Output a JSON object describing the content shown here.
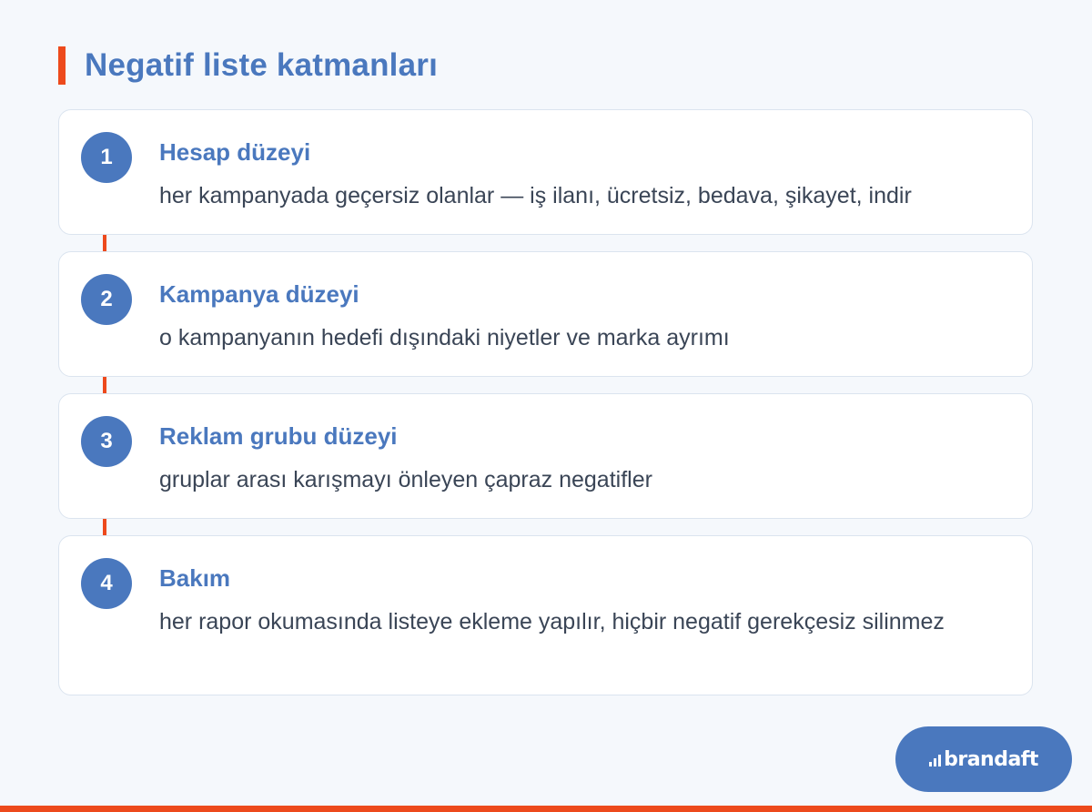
{
  "page": {
    "title": "Negatif liste katmanları"
  },
  "steps": [
    {
      "number": "1",
      "title": "Hesap düzeyi",
      "description": "her kampanyada geçersiz olanlar — iş ilanı, ücretsiz, bedava, şikayet, indir"
    },
    {
      "number": "2",
      "title": "Kampanya düzeyi",
      "description": "o kampanyanın hedefi dışındaki niyetler ve marka ayrımı"
    },
    {
      "number": "3",
      "title": "Reklam grubu düzeyi",
      "description": "gruplar arası karışmayı önleyen çapraz negatifler"
    },
    {
      "number": "4",
      "title": "Bakım",
      "description": "her rapor okumasında listeye ekleme yapılır, hiçbir negatif gerekçesiz silinmez"
    }
  ],
  "brand": {
    "name": "brandaft",
    "icon": "bar-chart-icon"
  },
  "colors": {
    "accent": "#ed4a1c",
    "primary": "#4a78be",
    "background": "#f5f8fc",
    "text": "#3a4556"
  }
}
